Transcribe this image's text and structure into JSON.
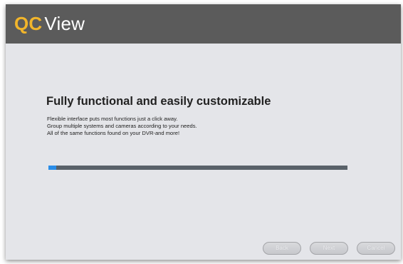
{
  "header": {
    "brand": "QC",
    "product": "View"
  },
  "main": {
    "title": "Fully functional and easily customizable",
    "description": [
      "Flexible interface puts most functions just a click away.",
      "Group multiple systems and cameras according to your needs.",
      "All of the same functions found on your DVR-and more!"
    ],
    "progress_fraction": 0.025
  },
  "footer": {
    "back_label": "Back",
    "next_label": "Next",
    "cancel_label": "Cancel",
    "buttons_disabled": true
  },
  "colors": {
    "header_bg": "#5b5b5b",
    "brand_accent": "#f1b52b",
    "body_bg": "#e4e5e9",
    "progress_track": "#596169",
    "progress_fill": "#2a8de8"
  }
}
